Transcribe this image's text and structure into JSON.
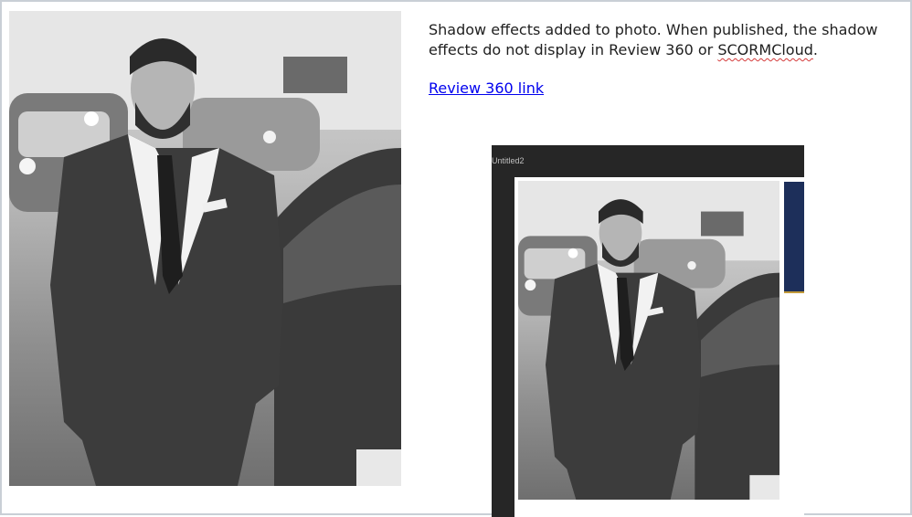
{
  "note": {
    "text_before": "Shadow effects added to photo. When published, the shadow effects do not display in Review 360 or ",
    "misspelled": "SCORMCloud",
    "text_after": "."
  },
  "link": {
    "label": "Review 360 link"
  },
  "preview": {
    "title": "Untitled2"
  },
  "colors": {
    "link": "#0000ee",
    "preview_bg": "#262626",
    "accent_navy": "#1d2f5a",
    "accent_gold": "#c29a3a"
  }
}
